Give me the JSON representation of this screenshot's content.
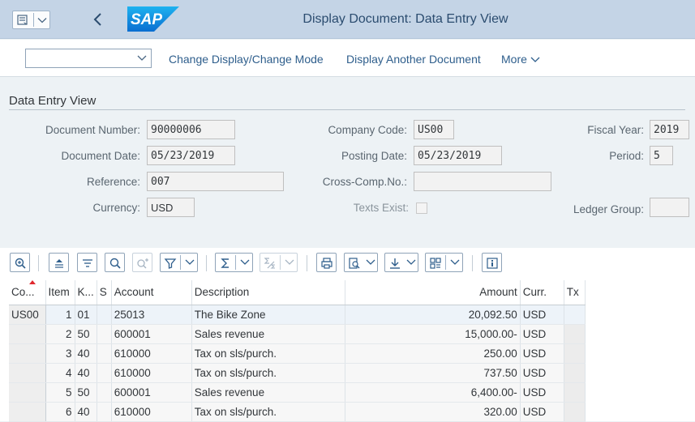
{
  "shell": {
    "title": "Display Document: Data Entry View",
    "logo_text": "SAP",
    "brand_color": "#0a6ed1"
  },
  "toolbar": {
    "dropdown_value": "",
    "change_mode_label": "Change Display/Change Mode",
    "display_another_label": "Display Another Document",
    "more_label": "More"
  },
  "section": {
    "title": "Data Entry View"
  },
  "header_fields": {
    "document_number": {
      "label": "Document Number:",
      "value": "90000006"
    },
    "company_code": {
      "label": "Company Code:",
      "value": "US00"
    },
    "fiscal_year": {
      "label": "Fiscal Year:",
      "value": "2019"
    },
    "document_date": {
      "label": "Document Date:",
      "value": "05/23/2019"
    },
    "posting_date": {
      "label": "Posting Date:",
      "value": "05/23/2019"
    },
    "period": {
      "label": "Period:",
      "value": "5"
    },
    "reference": {
      "label": "Reference:",
      "value": "007"
    },
    "cross_comp_no": {
      "label": "Cross-Comp.No.:",
      "value": ""
    },
    "currency": {
      "label": "Currency:",
      "value": "USD"
    },
    "texts_exist": {
      "label": "Texts Exist:",
      "checked": false
    },
    "ledger_group": {
      "label": "Ledger Group:",
      "value": ""
    }
  },
  "grid_toolbar_icons": [
    "zoom-icon",
    "align-top-icon",
    "filter-lines-icon",
    "search-icon",
    "search-next-icon",
    "filter-icon",
    "sum-icon",
    "subtotal-icon",
    "print-icon",
    "print-preview-icon",
    "export-icon",
    "layout-icon",
    "info-icon"
  ],
  "table": {
    "columns": [
      "Co...",
      "Item",
      "K...",
      "S",
      "Account",
      "Description",
      "Amount",
      "Curr.",
      "Tx"
    ],
    "rows": [
      {
        "co": "US00",
        "item": "1",
        "k": "01",
        "s": "",
        "account": "25013",
        "description": "The Bike Zone",
        "amount": "20,092.50",
        "curr": "USD",
        "tx": ""
      },
      {
        "co": "",
        "item": "2",
        "k": "50",
        "s": "",
        "account": "600001",
        "description": "Sales revenue",
        "amount": "15,000.00-",
        "curr": "USD",
        "tx": ""
      },
      {
        "co": "",
        "item": "3",
        "k": "40",
        "s": "",
        "account": "610000",
        "description": "Tax on sls/purch.",
        "amount": "250.00",
        "curr": "USD",
        "tx": ""
      },
      {
        "co": "",
        "item": "4",
        "k": "40",
        "s": "",
        "account": "610000",
        "description": "Tax on sls/purch.",
        "amount": "737.50",
        "curr": "USD",
        "tx": ""
      },
      {
        "co": "",
        "item": "5",
        "k": "50",
        "s": "",
        "account": "600001",
        "description": "Sales revenue",
        "amount": "6,400.00-",
        "curr": "USD",
        "tx": ""
      },
      {
        "co": "",
        "item": "6",
        "k": "40",
        "s": "",
        "account": "610000",
        "description": "Tax on sls/purch.",
        "amount": "320.00",
        "curr": "USD",
        "tx": ""
      }
    ]
  }
}
